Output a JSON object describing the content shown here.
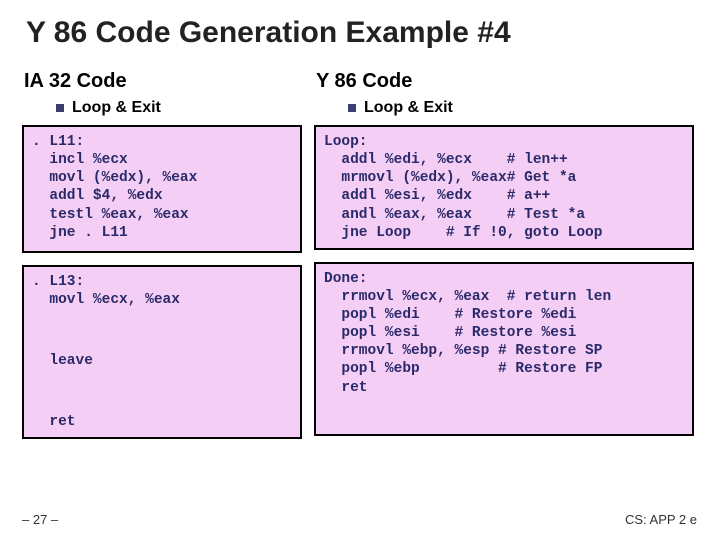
{
  "title": "Y 86 Code Generation Example #4",
  "left": {
    "heading": "IA 32 Code",
    "sub": "Loop & Exit",
    "box1": ". L11:\n  incl %ecx\n  movl (%edx), %eax\n  addl $4, %edx\n  testl %eax, %eax\n  jne . L11",
    "box2_a": ". L13:\n  movl %ecx, %eax",
    "box2_b": "  leave",
    "box2_c": "  ret"
  },
  "right": {
    "heading": "Y 86 Code",
    "sub": "Loop & Exit",
    "box1": "Loop:\n  addl %edi, %ecx    # len++\n  mrmovl (%edx), %eax# Get *a\n  addl %esi, %edx    # a++\n  andl %eax, %eax    # Test *a\n  jne Loop    # If !0, goto Loop",
    "box2": "Done:\n  rrmovl %ecx, %eax  # return len\n  popl %edi    # Restore %edi\n  popl %esi    # Restore %esi\n  rrmovl %ebp, %esp # Restore SP\n  popl %ebp         # Restore FP\n  ret"
  },
  "footer": {
    "left": "– 27 –",
    "right": "CS: APP 2 e"
  }
}
